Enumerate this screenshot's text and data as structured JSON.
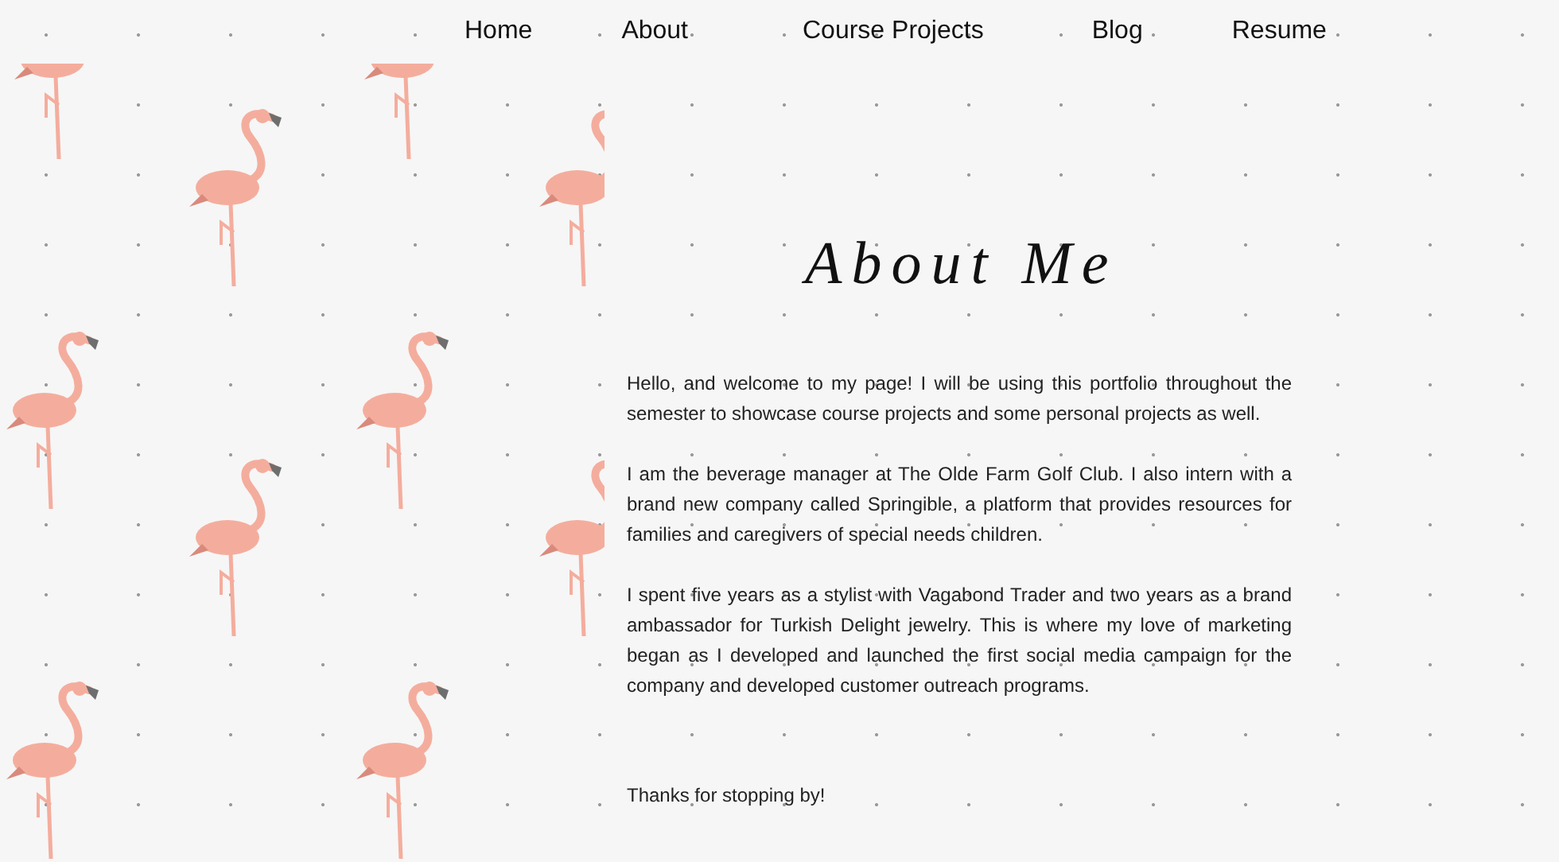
{
  "nav": {
    "items": [
      {
        "label": "Home"
      },
      {
        "label": "About"
      },
      {
        "label": "Course Projects"
      },
      {
        "label": "Blog"
      },
      {
        "label": "Resume"
      }
    ]
  },
  "title": "About Me",
  "paragraphs": [
    "Hello, and welcome to my page! I will be using this portfolio throughout the semester to showcase course projects and some personal projects as well.",
    "I am the beverage manager at The Olde Farm Golf Club. I also intern with a brand new company called Springible, a platform that provides resources for families and caregivers of special needs children.",
    "I spent five years as a stylist with Vagabond Trader and two years as a brand ambassador for Turkish Delight jewelry.  This is where my love of marketing began as I developed and launched the first social media campaign for the company and developed customer outreach programs."
  ],
  "closing": "Thanks for stopping by!"
}
